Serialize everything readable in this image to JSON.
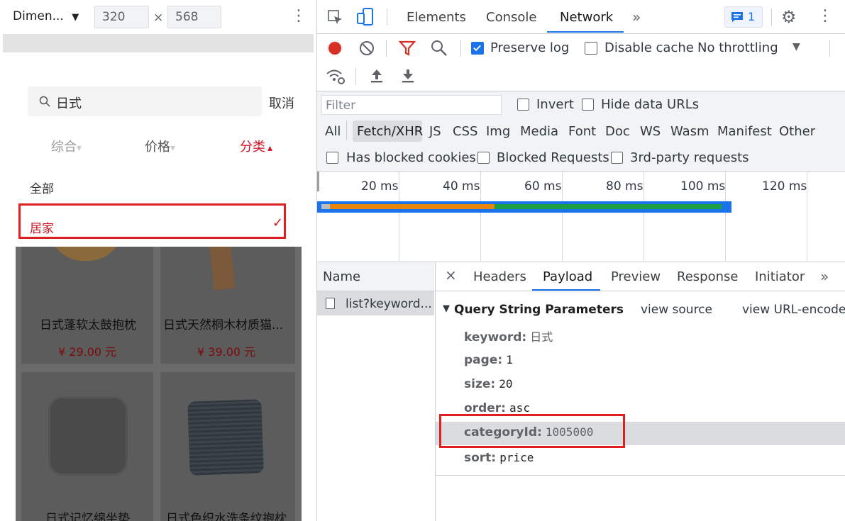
{
  "device_toolbar": {
    "dimension_label": "Dimen...",
    "width_value": "320",
    "height_value": "568",
    "times": "×"
  },
  "app": {
    "search": {
      "query": "日式",
      "cancel": "取消"
    },
    "sort_tabs": [
      {
        "label": "综合",
        "arrow": "▾",
        "active": false
      },
      {
        "label": "价格",
        "arrow": "▾",
        "active": false
      },
      {
        "label": "分类",
        "arrow": "▴",
        "active": true
      }
    ],
    "category_menu": {
      "all": "全部",
      "home": "居家",
      "check": "✓"
    },
    "products": [
      {
        "name": "日式蓬软太鼓抱枕",
        "price": "¥ 29.00 元"
      },
      {
        "name": "日式天然桐木材质猫...",
        "price": "¥ 39.00 元"
      },
      {
        "name": "日式记忆绵坐垫",
        "price": ""
      },
      {
        "name": "日式色织水洗条纹抱枕",
        "price": ""
      }
    ]
  },
  "devtools": {
    "tabs": [
      "Elements",
      "Console",
      "Network"
    ],
    "active_tab": "Network",
    "more": "»",
    "issues_count": "1",
    "toolbar": {
      "preserve_log": "Preserve log",
      "disable_cache": "Disable cache",
      "throttling": "No throttling"
    },
    "filter": {
      "placeholder": "Filter",
      "invert": "Invert",
      "hide_data_urls": "Hide data URLs"
    },
    "types": [
      "All",
      "Fetch/XHR",
      "JS",
      "CSS",
      "Img",
      "Media",
      "Font",
      "Doc",
      "WS",
      "Wasm",
      "Manifest",
      "Other"
    ],
    "active_type": "Fetch/XHR",
    "cookie_filters": {
      "has_blocked_cookies": "Has blocked cookies",
      "blocked_requests": "Blocked Requests",
      "third_party": "3rd-party requests"
    },
    "timeline_labels": [
      "20 ms",
      "40 ms",
      "60 ms",
      "80 ms",
      "100 ms",
      "120 ms"
    ],
    "requests": {
      "header": "Name",
      "items": [
        "list?keyword..."
      ]
    },
    "detail_tabs": [
      "Headers",
      "Payload",
      "Preview",
      "Response",
      "Initiator"
    ],
    "active_detail_tab": "Payload",
    "close": "×",
    "query_section": {
      "title": "Query String Parameters",
      "view_source": "view source",
      "view_url_encoded": "view URL-encoded"
    },
    "params": [
      {
        "key": "keyword:",
        "value": "日式"
      },
      {
        "key": "page:",
        "value": "1"
      },
      {
        "key": "size:",
        "value": "20"
      },
      {
        "key": "order:",
        "value": "asc"
      },
      {
        "key": "categoryId:",
        "value": "1005000"
      },
      {
        "key": "sort:",
        "value": "price"
      }
    ]
  },
  "colors": {
    "accent": "#1a73e8",
    "record_red": "#d93025",
    "brand_red": "#cf1322",
    "highlight_box": "#e02020"
  }
}
